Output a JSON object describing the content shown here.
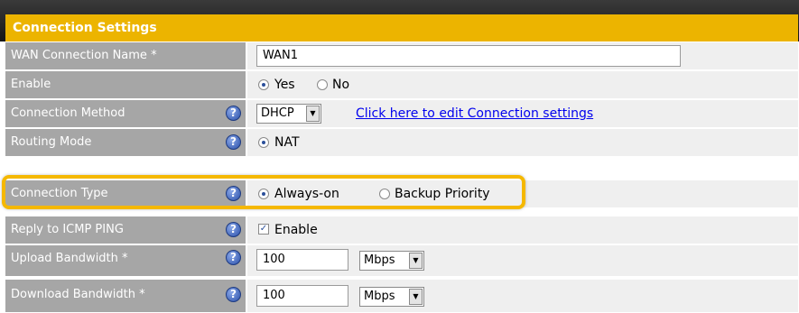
{
  "section_title": "Connection Settings",
  "fields": {
    "wan_name": {
      "label": "WAN Connection Name *",
      "value": "WAN1"
    },
    "enable": {
      "label": "Enable",
      "yes": "Yes",
      "no": "No",
      "selected": "Yes"
    },
    "connection_method": {
      "label": "Connection Method",
      "value": "DHCP",
      "link": "Click here to edit Connection settings"
    },
    "routing_mode": {
      "label": "Routing Mode",
      "option": "NAT"
    },
    "connection_type": {
      "label": "Connection Type",
      "always_on": "Always-on",
      "backup": "Backup Priority",
      "selected": "Always-on"
    },
    "icmp_ping": {
      "label": "Reply to ICMP PING",
      "checkbox_label": "Enable",
      "checked": true
    },
    "upload": {
      "label": "Upload Bandwidth *",
      "value": "100",
      "unit": "Mbps"
    },
    "download": {
      "label": "Download Bandwidth *",
      "value": "100",
      "unit": "Mbps"
    }
  },
  "icons": {
    "help": "help-icon",
    "dropdown": "dropdown-arrow-icon",
    "checkmark": "checkmark-icon"
  },
  "colors": {
    "header_gold": "#ecb400",
    "label_gray": "#a6a6a6",
    "highlight": "#f5b800",
    "link": "#0000ee"
  }
}
